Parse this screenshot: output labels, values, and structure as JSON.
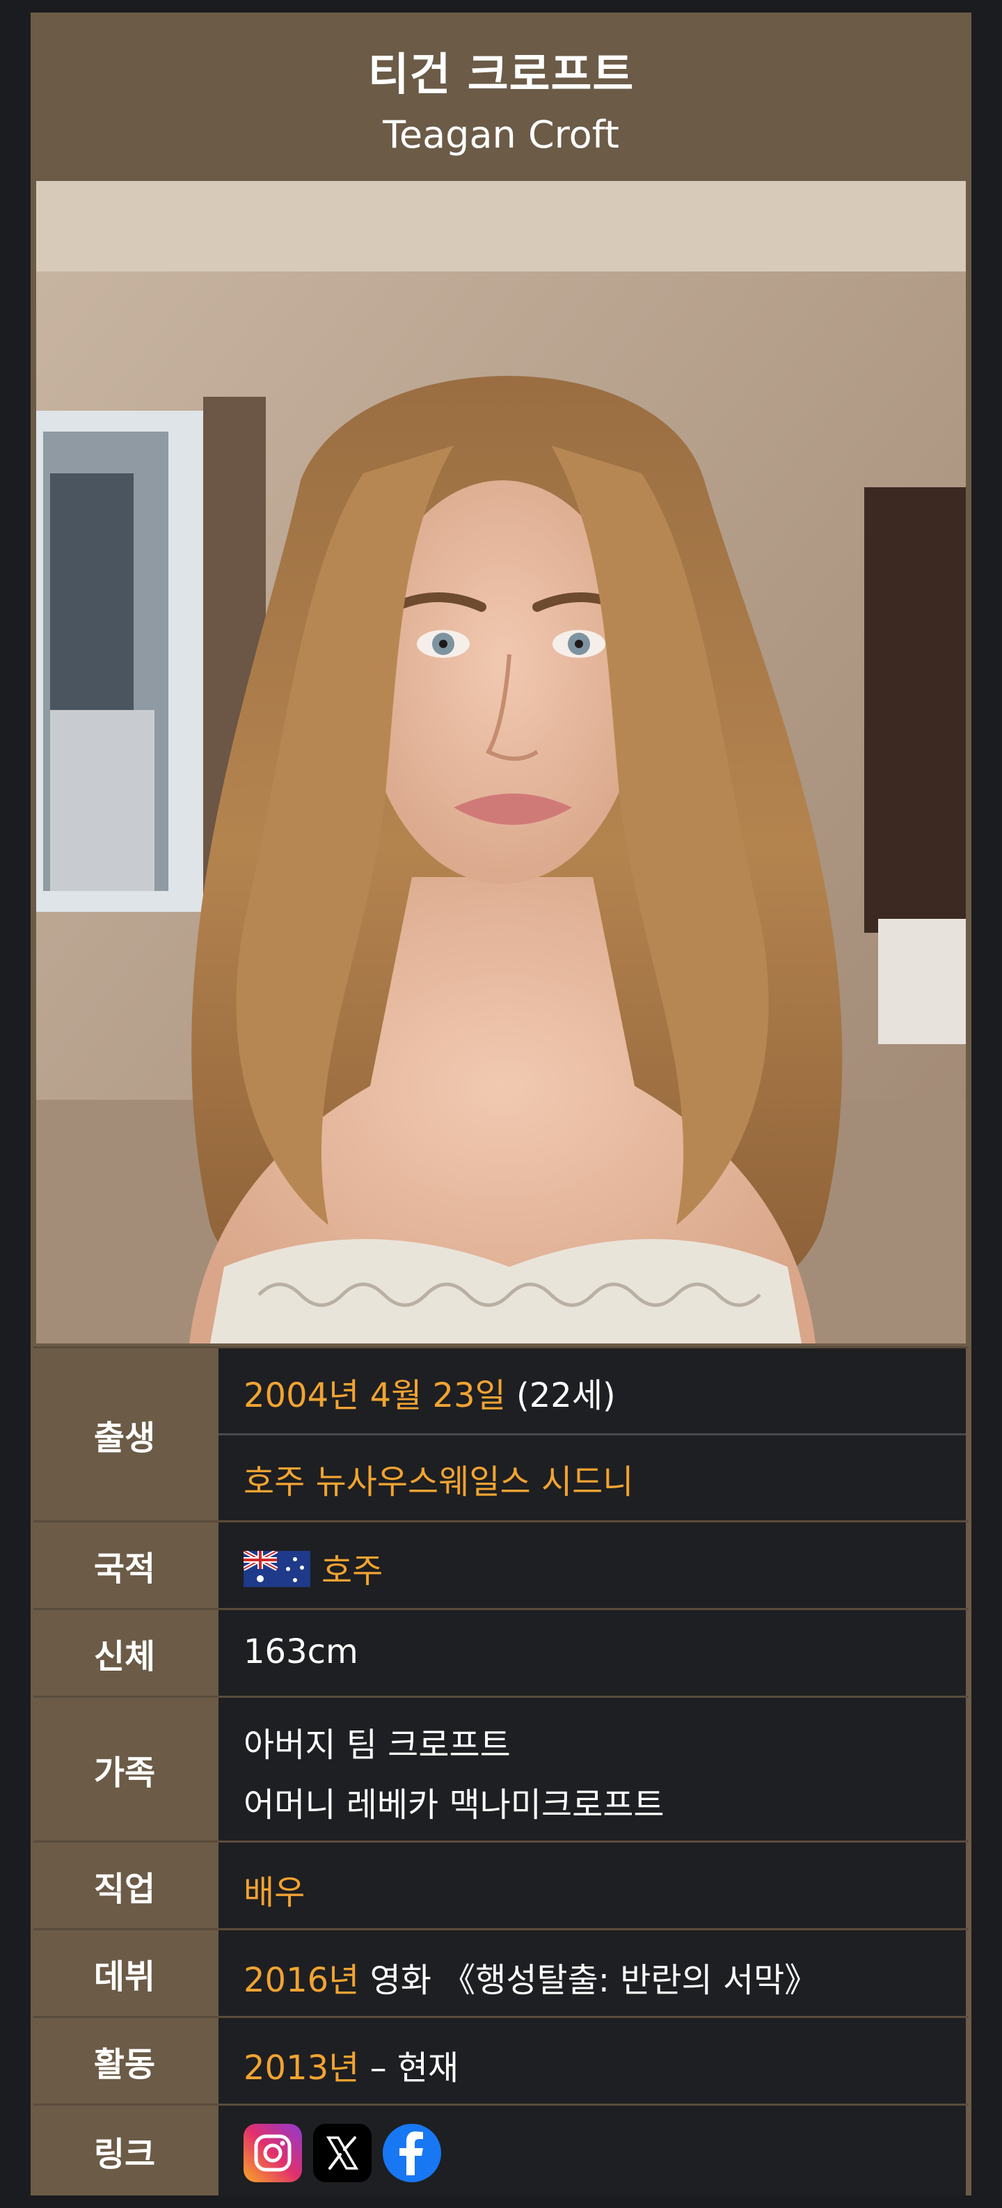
{
  "profile": {
    "name_ko": "티건 크로프트",
    "name_en": "Teagan Croft"
  },
  "photo": {
    "description_icon": "portrait-photo"
  },
  "rows": {
    "birth": {
      "label": "출생",
      "date": "2004년 4월 23일",
      "age": " (22세)",
      "place": "호주 뉴사우스웨일스 시드니"
    },
    "nationality": {
      "label": "국적",
      "flag_icon": "australia-flag-icon",
      "value": "호주"
    },
    "body": {
      "label": "신체",
      "value": "163cm"
    },
    "family": {
      "label": "가족",
      "father": "아버지 팀 크로프트",
      "mother": "어머니 레베카 맥나미크로프트"
    },
    "occupation": {
      "label": "직업",
      "value": "배우"
    },
    "debut": {
      "label": "데뷔",
      "year": "2016년",
      "work": " 영화 《행성탈출: 반란의 서막》"
    },
    "activity": {
      "label": "활동",
      "year": "2013년",
      "rest": " – 현재"
    },
    "links": {
      "label": "링크",
      "icons": [
        "instagram-icon",
        "x-icon",
        "facebook-icon"
      ]
    }
  },
  "colors": {
    "header_bg": "#6b5b47",
    "value_bg": "#1e1f22",
    "accent": "#f2a332"
  }
}
